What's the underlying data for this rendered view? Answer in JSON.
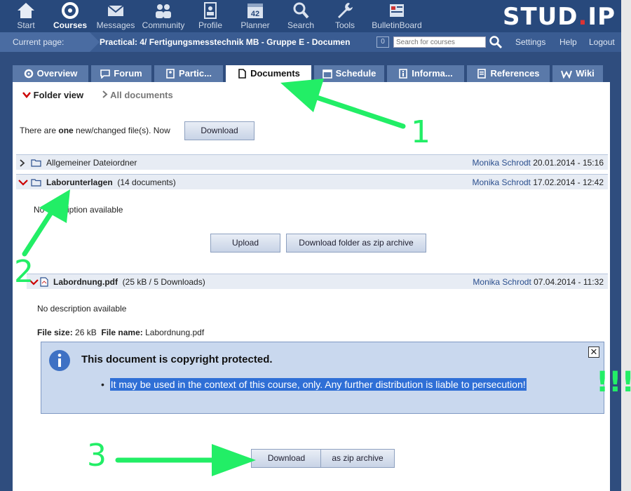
{
  "nav": {
    "items": [
      {
        "label": "Start",
        "icon": "home-icon"
      },
      {
        "label": "Courses",
        "icon": "courses-icon"
      },
      {
        "label": "Messages",
        "icon": "envelope-icon"
      },
      {
        "label": "Community",
        "icon": "people-icon"
      },
      {
        "label": "Profile",
        "icon": "profile-icon"
      },
      {
        "label": "Planner",
        "icon": "calendar-icon"
      },
      {
        "label": "Search",
        "icon": "search-icon"
      },
      {
        "label": "Tools",
        "icon": "wrench-icon"
      },
      {
        "label": "BulletinBoard",
        "icon": "board-icon"
      }
    ],
    "logo_main": "STUD",
    "logo_dot": ".",
    "logo_end": "IP",
    "planner_day": "42"
  },
  "current": {
    "label": "Current page:",
    "title": "Practical: 4/ Fertigungsmesstechnik MB - Gruppe E - Documen",
    "badge": "0",
    "search_placeholder": "Search for courses",
    "links": [
      "Settings",
      "Help",
      "Logout"
    ]
  },
  "tabs": [
    "Overview",
    "Forum",
    "Partic...",
    "Documents",
    "Schedule",
    "Informa...",
    "References",
    "Wiki"
  ],
  "views": {
    "folder": "Folder view",
    "all": "All documents"
  },
  "notice": {
    "pre": "There are ",
    "strong": "one",
    "post": " new/changed file(s). Now",
    "button": "Download"
  },
  "folders": [
    {
      "name": "Allgemeiner Dateiordner",
      "user": "Monika Schrodt",
      "date": "20.01.2014 - 15:16"
    },
    {
      "name": "Laborunterlagen",
      "count": "(14 documents)",
      "user": "Monika Schrodt",
      "date": "17.02.2014 - 12:42"
    }
  ],
  "folder_desc": "No description available",
  "folder_buttons": {
    "upload": "Upload",
    "zip": "Download folder as zip archive"
  },
  "file": {
    "name": "Labordnung.pdf",
    "info": "(25 kB / 5 Downloads)",
    "user": "Monika Schrodt",
    "date": "07.04.2014 - 11:32",
    "desc": "No description available",
    "size_label": "File size:",
    "size": "26 kB",
    "fname_label": "File name:",
    "fname": "Labordnung.pdf"
  },
  "copyright": {
    "heading": "This document is copyright protected.",
    "text": "It may be used in the context of this course, only. Any further distribution is liable to persecution!",
    "close": "✕"
  },
  "download": {
    "main": "Download",
    "zip": "as zip archive"
  },
  "annotations": {
    "one": "1",
    "two": "2",
    "three": "3",
    "bang": "!!!",
    "color": "#22ee66"
  }
}
